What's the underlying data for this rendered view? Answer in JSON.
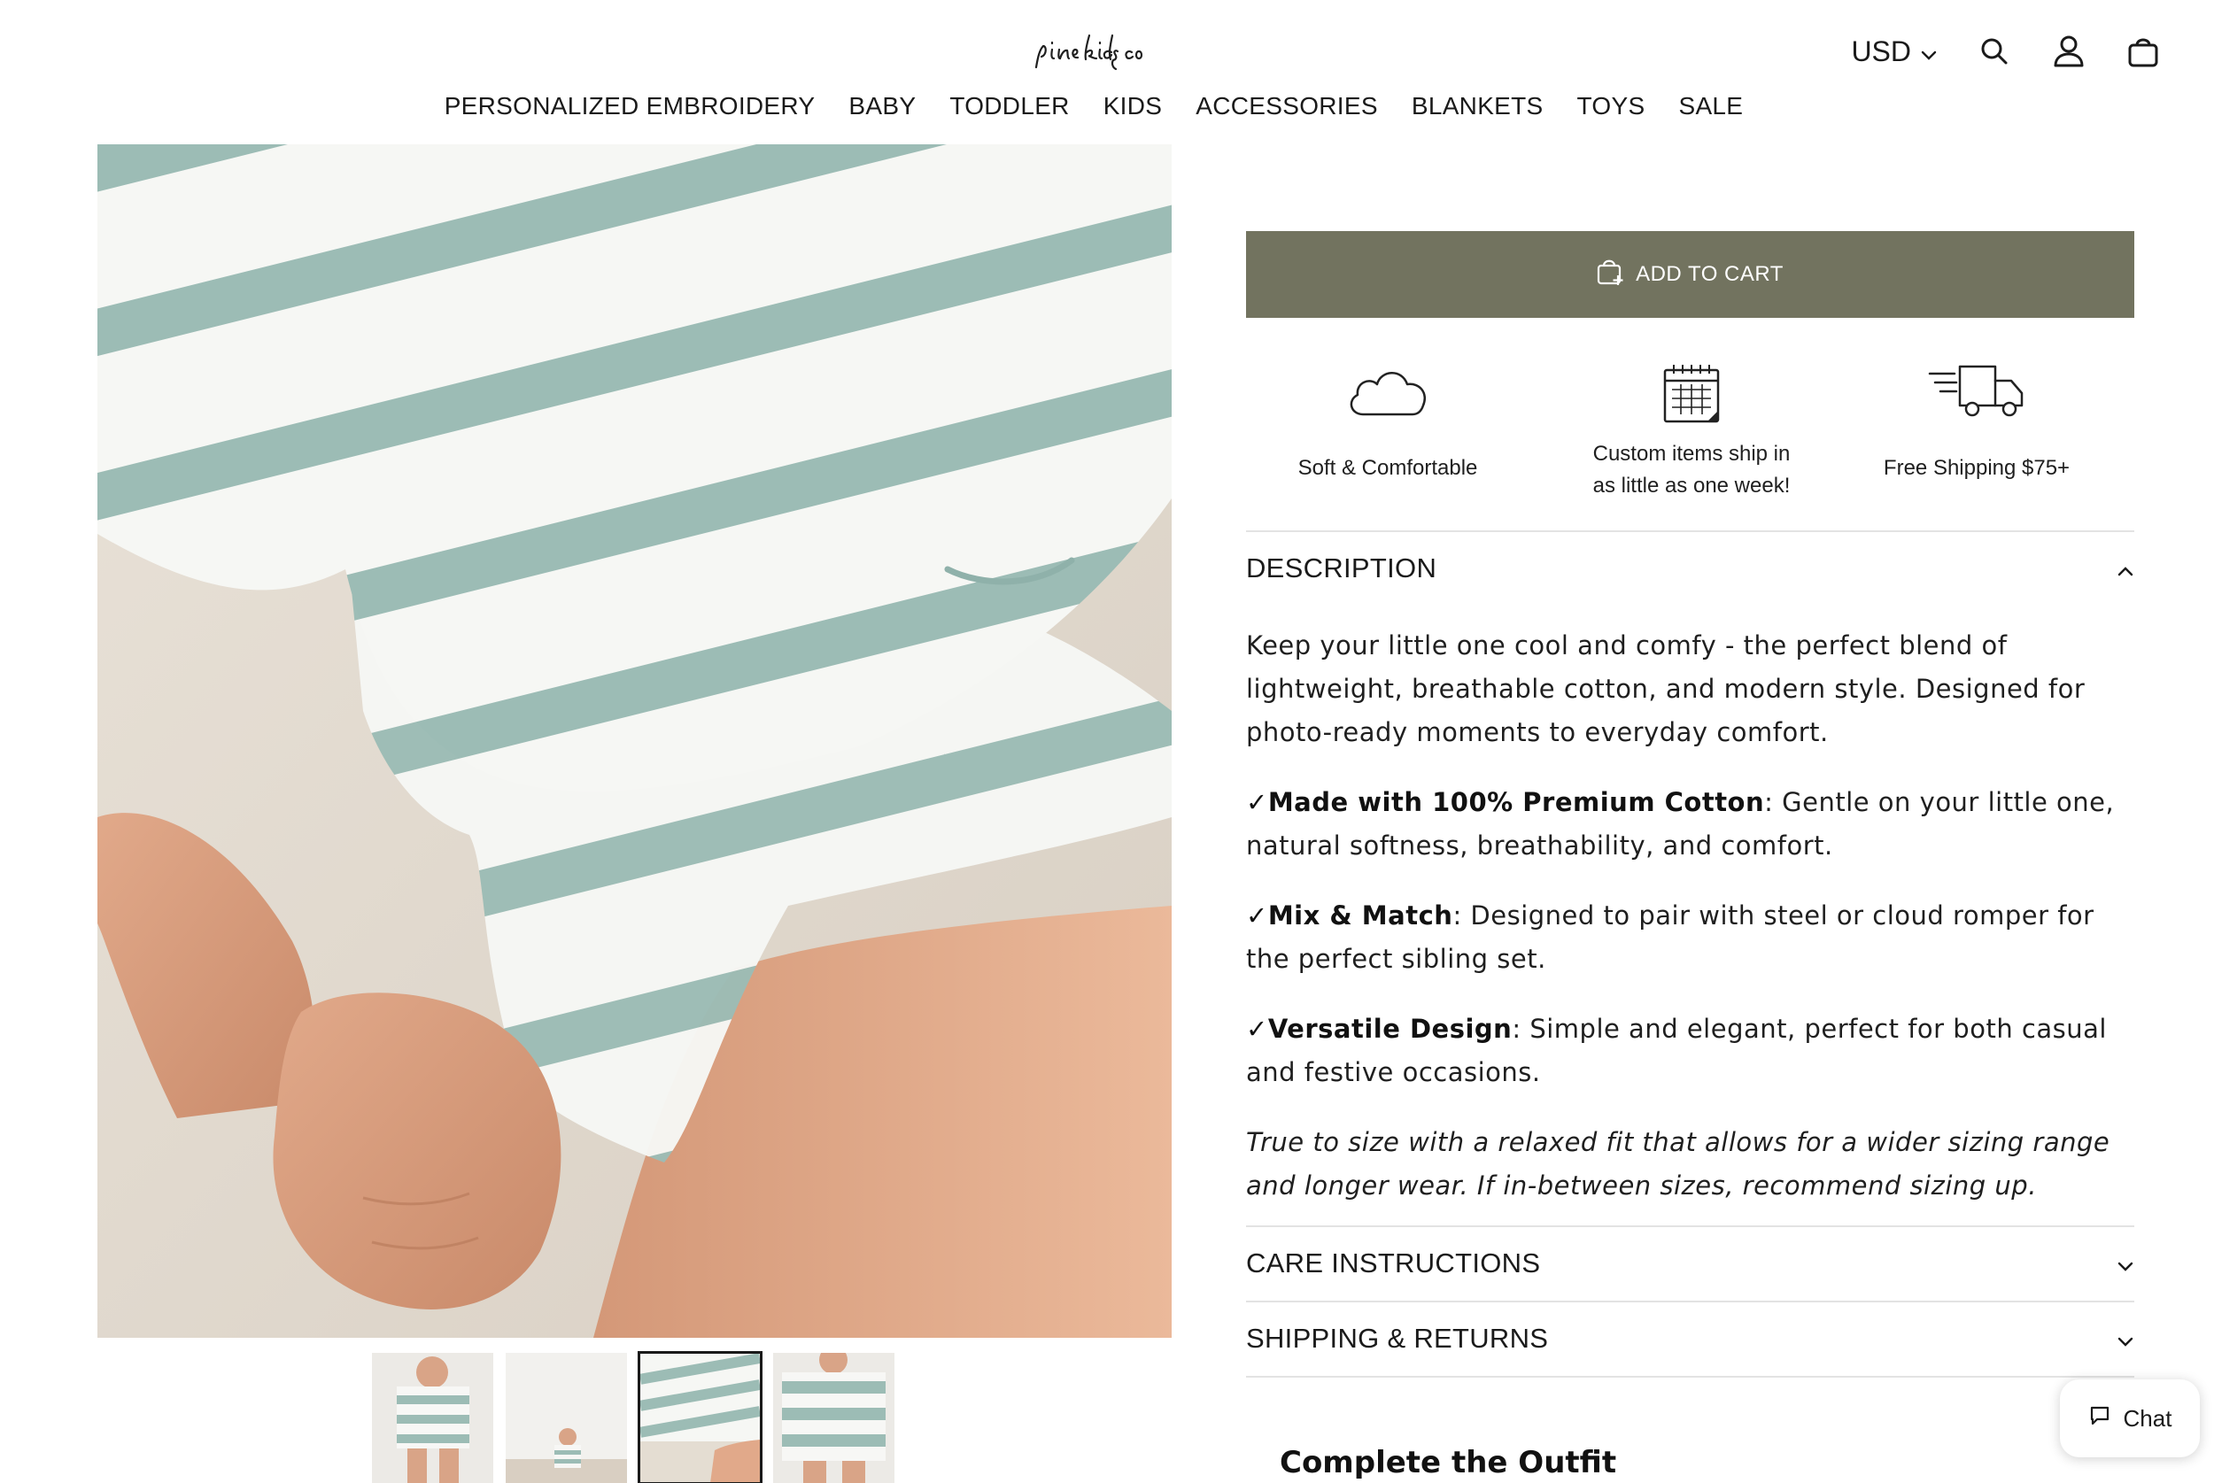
{
  "header": {
    "logo_text": "pine kids co",
    "currency": "USD",
    "icons": [
      "chevron-down-icon",
      "search-icon",
      "account-icon",
      "cart-icon"
    ]
  },
  "nav": {
    "items": [
      {
        "label": "PERSONALIZED EMBROIDERY"
      },
      {
        "label": "BABY"
      },
      {
        "label": "TODDLER"
      },
      {
        "label": "KIDS"
      },
      {
        "label": "ACCESSORIES"
      },
      {
        "label": "BLANKETS"
      },
      {
        "label": "TOYS"
      },
      {
        "label": "SALE"
      }
    ]
  },
  "gallery": {
    "main_image": "striped-romper-closeup",
    "thumbnails": [
      {
        "name": "child-standing-front",
        "active": false
      },
      {
        "name": "child-sitting-floor",
        "active": false
      },
      {
        "name": "romper-closeup",
        "active": true
      },
      {
        "name": "child-standing-close",
        "active": false
      }
    ]
  },
  "product": {
    "add_to_cart_label": "ADD TO CART",
    "features": [
      {
        "icon": "cloud-icon",
        "line1": "Soft & Comfortable",
        "line2": ""
      },
      {
        "icon": "calendar-icon",
        "line1": "Custom items ship in",
        "line2": "as little as one week!"
      },
      {
        "icon": "delivery-truck-icon",
        "line1": "Free Shipping $75+",
        "line2": ""
      }
    ]
  },
  "description": {
    "heading": "DESCRIPTION",
    "intro": "Keep your little one cool and comfy - the perfect blend of lightweight, breathable cotton, and modern style. Designed for photo-ready moments to everyday comfort.",
    "bullets": [
      {
        "check": "✓",
        "title": "Made with 100% Premium Cotton",
        "text": ": Gentle on your little one, natural softness, breathability, and comfort."
      },
      {
        "check": "✓",
        "title": "Mix & Match",
        "text": ": Designed to pair with steel or cloud romper for the perfect sibling set."
      },
      {
        "check": "✓",
        "title": "Versatile Design",
        "text": ": Simple and elegant, perfect for both casual and festive occasions."
      }
    ],
    "fit_note": "True to size with a relaxed fit that allows for a wider sizing range and longer wear. If in-between sizes, recommend sizing up."
  },
  "accordions": {
    "care": "CARE INSTRUCTIONS",
    "shipping": "SHIPPING & RETURNS"
  },
  "complete_outfit": "Complete the Outfit",
  "chat": {
    "label": "Chat"
  },
  "colors": {
    "button": "#72735f",
    "stripe": "#9cbcb5",
    "divider": "#e3e3e3"
  }
}
